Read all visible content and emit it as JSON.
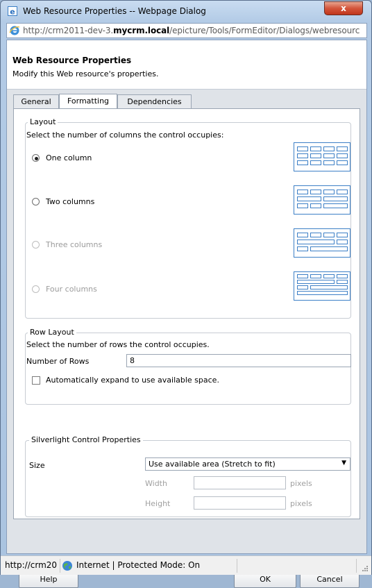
{
  "window": {
    "title": "Web Resource Properties -- Webpage Dialog",
    "close_label": "x",
    "address_prefix": "http://crm2011-dev-3.",
    "address_domain": "mycrm.local",
    "address_suffix": "/epicture/Tools/FormEditor/Dialogs/webresourc"
  },
  "header": {
    "title": "Web Resource Properties",
    "subtitle": "Modify this Web resource's properties."
  },
  "tabs": [
    {
      "label": "General",
      "active": false
    },
    {
      "label": "Formatting",
      "active": true
    },
    {
      "label": "Dependencies",
      "active": false
    }
  ],
  "layout": {
    "legend": "Layout",
    "description": "Select the number of columns the control occupies:",
    "options": [
      {
        "label": "One column",
        "checked": true,
        "enabled": true,
        "icon": "one-column-layout-icon"
      },
      {
        "label": "Two columns",
        "checked": false,
        "enabled": true,
        "icon": "two-column-layout-icon"
      },
      {
        "label": "Three columns",
        "checked": false,
        "enabled": false,
        "icon": "three-column-layout-icon"
      },
      {
        "label": "Four columns",
        "checked": false,
        "enabled": false,
        "icon": "four-column-layout-icon"
      }
    ]
  },
  "row_layout": {
    "legend": "Row Layout",
    "description": "Select the number of rows the control occupies.",
    "rows_label": "Number of Rows",
    "rows_value": "8",
    "expand_label": "Automatically expand to use available space.",
    "expand_checked": false
  },
  "silverlight": {
    "legend": "Silverlight Control Properties",
    "size_label": "Size",
    "size_value": "Use available area (Stretch to fit)",
    "width_label": "Width",
    "height_label": "Height",
    "width_value": "",
    "height_value": "",
    "units": "pixels"
  },
  "buttons": {
    "help": "Help",
    "ok": "OK",
    "cancel": "Cancel"
  },
  "status": {
    "url": "http://crm20",
    "zone": "Internet | Protected Mode: On"
  },
  "colors": {
    "accent": "#d3553b",
    "frame": "#b3cbe6",
    "icon_blue": "#3c7fc6"
  }
}
